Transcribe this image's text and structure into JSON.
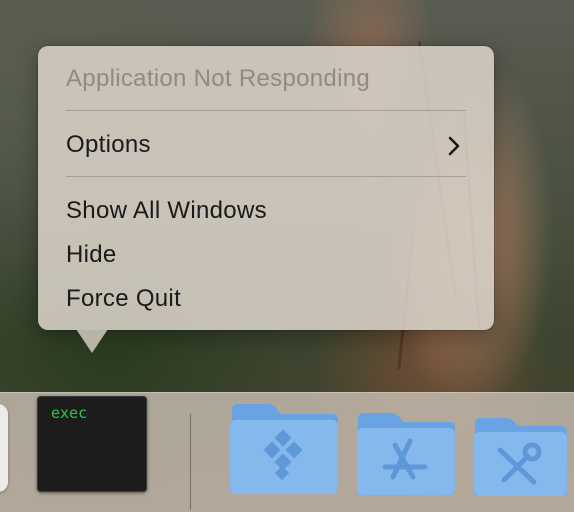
{
  "menu": {
    "header": "Application Not Responding",
    "items": [
      {
        "label": "Options",
        "has_submenu": true
      },
      {
        "label": "Show All Windows"
      },
      {
        "label": "Hide"
      },
      {
        "label": "Force Quit"
      }
    ]
  },
  "dock": {
    "terminal_text": "exec",
    "apps": [
      "terminal-icon",
      "folder-workspace-icon",
      "folder-applications-icon",
      "folder-utilities-icon"
    ]
  },
  "colors": {
    "folder_blue": "#7fb4ec",
    "folder_tab": "#6aa3e3",
    "terminal_green": "#35c24a"
  }
}
